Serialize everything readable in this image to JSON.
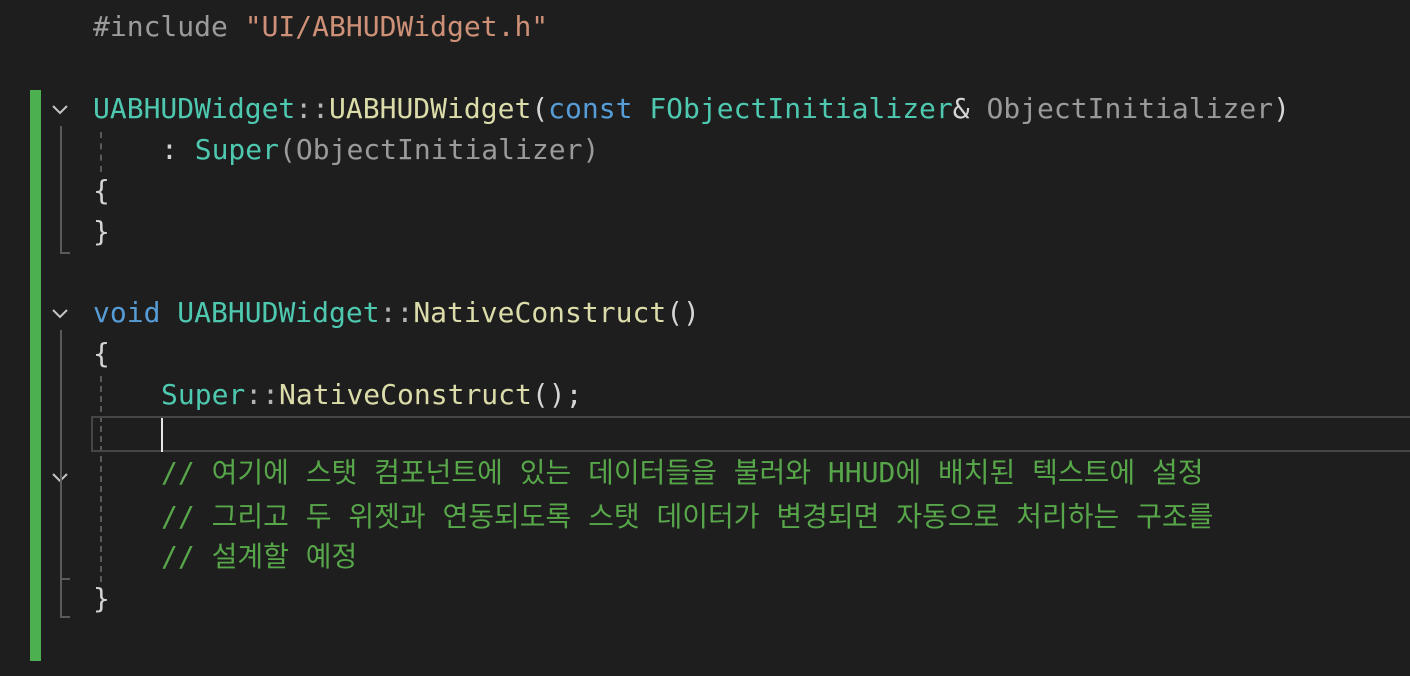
{
  "editor": {
    "include_directive": "#include",
    "include_path": "\"UI/ABHUDWidget.h\"",
    "constructor": {
      "class_name": "UABHUDWidget",
      "scope": "::",
      "method": "UABHUDWidget",
      "open_paren": "(",
      "keyword_const": "const",
      "param_type": "FObjectInitializer",
      "ampersand": "&",
      "param_name": "ObjectInitializer",
      "close_paren": ")",
      "init_colon": ":",
      "super": "Super",
      "init_arg": "(ObjectInitializer)",
      "brace_open": "{",
      "brace_close": "}"
    },
    "native_construct": {
      "return_type": "void",
      "class_name": "UABHUDWidget",
      "scope": "::",
      "method": "NativeConstruct",
      "parens": "()",
      "brace_open": "{",
      "super": "Super",
      "super_scope": "::",
      "super_call": "NativeConstruct",
      "call_tail": "();",
      "comment_1": "// 여기에 스탯 컴포넌트에 있는 데이터들을 불러와 HHUD에 배치된 텍스트에 설정",
      "comment_2": "// 그리고 두 위젯과 연동되도록 스탯 데이터가 변경되면 자동으로 처리하는 구조를",
      "comment_3": "// 설계할 예정",
      "brace_close": "}"
    },
    "colors": {
      "background": "#1e1e1e",
      "keyword": "#569cd6",
      "type": "#4ec9b0",
      "function": "#dcdcaa",
      "string": "#ce9178",
      "comment": "#57a64a",
      "change_bar": "#4caf50"
    },
    "icons": [
      "fold-chevron-icon",
      "text-caret"
    ]
  }
}
